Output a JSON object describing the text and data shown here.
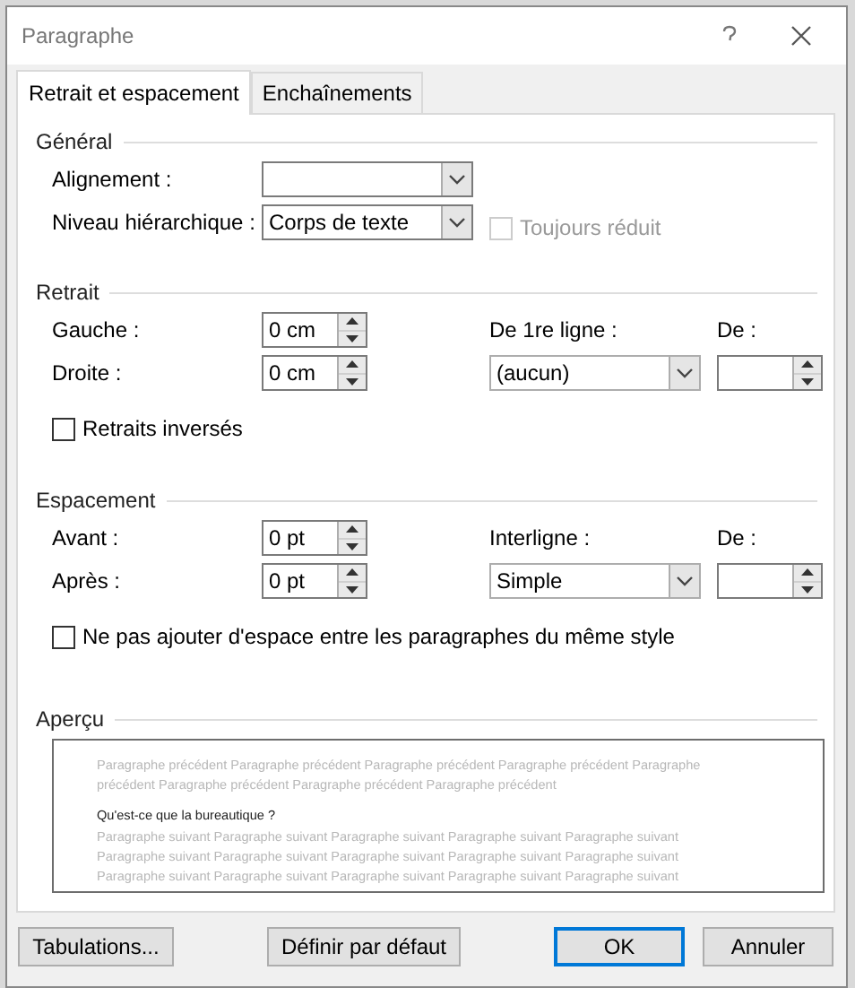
{
  "window": {
    "title": "Paragraphe"
  },
  "tabs": [
    {
      "label": "Retrait et espacement",
      "selected": true
    },
    {
      "label": "Enchaînements",
      "selected": false
    }
  ],
  "general": {
    "heading": "Général",
    "alignment": {
      "label": "Alignement :"
    },
    "outline_level": {
      "label": "Niveau hiérarchique :",
      "value": "Corps de texte"
    },
    "collapsed": {
      "label": "Toujours réduit",
      "checked": false,
      "disabled": true
    }
  },
  "indent": {
    "heading": "Retrait",
    "left": {
      "label": "Gauche :",
      "value": "0 cm"
    },
    "right": {
      "label": "Droite :",
      "value": "0 cm"
    },
    "special": {
      "label": "De 1re ligne :",
      "value": "(aucun)"
    },
    "by": {
      "label": "De :"
    },
    "mirror": {
      "label": "Retraits inversés",
      "checked": false,
      "disabled": false
    }
  },
  "spacing": {
    "heading": "Espacement",
    "before": {
      "label": "Avant :",
      "value": "0 pt"
    },
    "after": {
      "label": "Après :",
      "value": "0 pt"
    },
    "line_spacing": {
      "label": "Interligne :",
      "value": "Simple"
    },
    "at": {
      "label": "De :"
    },
    "dont_add": {
      "label": "Ne pas ajouter d'espace entre les paragraphes du même style",
      "checked": false,
      "disabled": false
    }
  },
  "preview": {
    "heading": "Aperçu",
    "lines": [
      {
        "kind": "previous",
        "text": "Paragraphe précédent Paragraphe précédent Paragraphe précédent Paragraphe précédent Paragraphe"
      },
      {
        "kind": "previous",
        "text": "précédent Paragraphe précédent Paragraphe précédent Paragraphe précédent"
      },
      {
        "kind": "current",
        "text": "Qu'est-ce que la bureautique ?"
      },
      {
        "kind": "next",
        "text": "Paragraphe suivant Paragraphe suivant Paragraphe suivant Paragraphe suivant Paragraphe suivant"
      },
      {
        "kind": "next",
        "text": "Paragraphe suivant Paragraphe suivant Paragraphe suivant Paragraphe suivant Paragraphe suivant"
      },
      {
        "kind": "next",
        "text": "Paragraphe suivant Paragraphe suivant Paragraphe suivant Paragraphe suivant Paragraphe suivant"
      }
    ]
  },
  "buttons": [
    {
      "label": "Tabulations...",
      "default": false
    },
    {
      "label": "Définir par défaut",
      "default": false
    },
    {
      "label": "OK",
      "default": true
    },
    {
      "label": "Annuler",
      "default": false
    }
  ]
}
